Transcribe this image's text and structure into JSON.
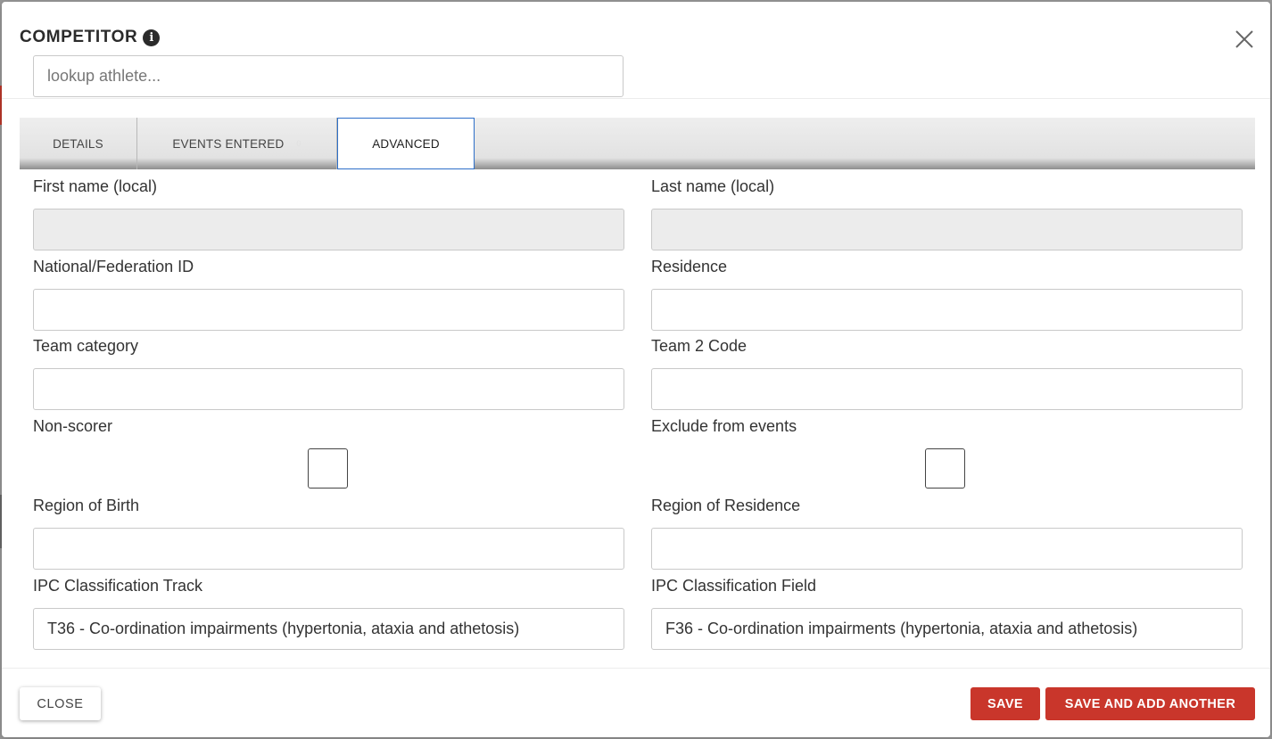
{
  "modal": {
    "title": "COMPETITOR",
    "info_icon": "i",
    "close_icon": "close-icon",
    "lookup_placeholder": "lookup athlete..."
  },
  "tabs": [
    {
      "label": "DETAILS",
      "active": false
    },
    {
      "label": "EVENTS ENTERED",
      "count": "0",
      "active": false
    },
    {
      "label": "ADVANCED",
      "active": true
    }
  ],
  "form": {
    "first_name_local": {
      "label": "First name (local)",
      "value": "",
      "disabled": true
    },
    "last_name_local": {
      "label": "Last name (local)",
      "value": "",
      "disabled": true
    },
    "national_id": {
      "label": "National/Federation ID",
      "value": ""
    },
    "residence": {
      "label": "Residence",
      "value": ""
    },
    "team_category": {
      "label": "Team category",
      "value": ""
    },
    "team2_code": {
      "label": "Team 2 Code",
      "value": ""
    },
    "non_scorer": {
      "label": "Non-scorer",
      "checked": false
    },
    "exclude_from_events": {
      "label": "Exclude from events",
      "checked": false
    },
    "region_of_birth": {
      "label": "Region of Birth",
      "value": ""
    },
    "region_of_residence": {
      "label": "Region of Residence",
      "value": ""
    },
    "ipc_track": {
      "label": "IPC Classification Track",
      "value": "T36 - Co-ordination impairments (hypertonia, ataxia and athetosis)"
    },
    "ipc_field": {
      "label": "IPC Classification Field",
      "value": "F36 - Co-ordination impairments (hypertonia, ataxia and athetosis)"
    }
  },
  "footer": {
    "close_label": "CLOSE",
    "save_label": "SAVE",
    "save_add_label": "SAVE AND ADD ANOTHER"
  },
  "colors": {
    "primary_button": "#c9362b",
    "active_tab_border": "#2d6fc9",
    "disabled_field": "#ececec"
  }
}
